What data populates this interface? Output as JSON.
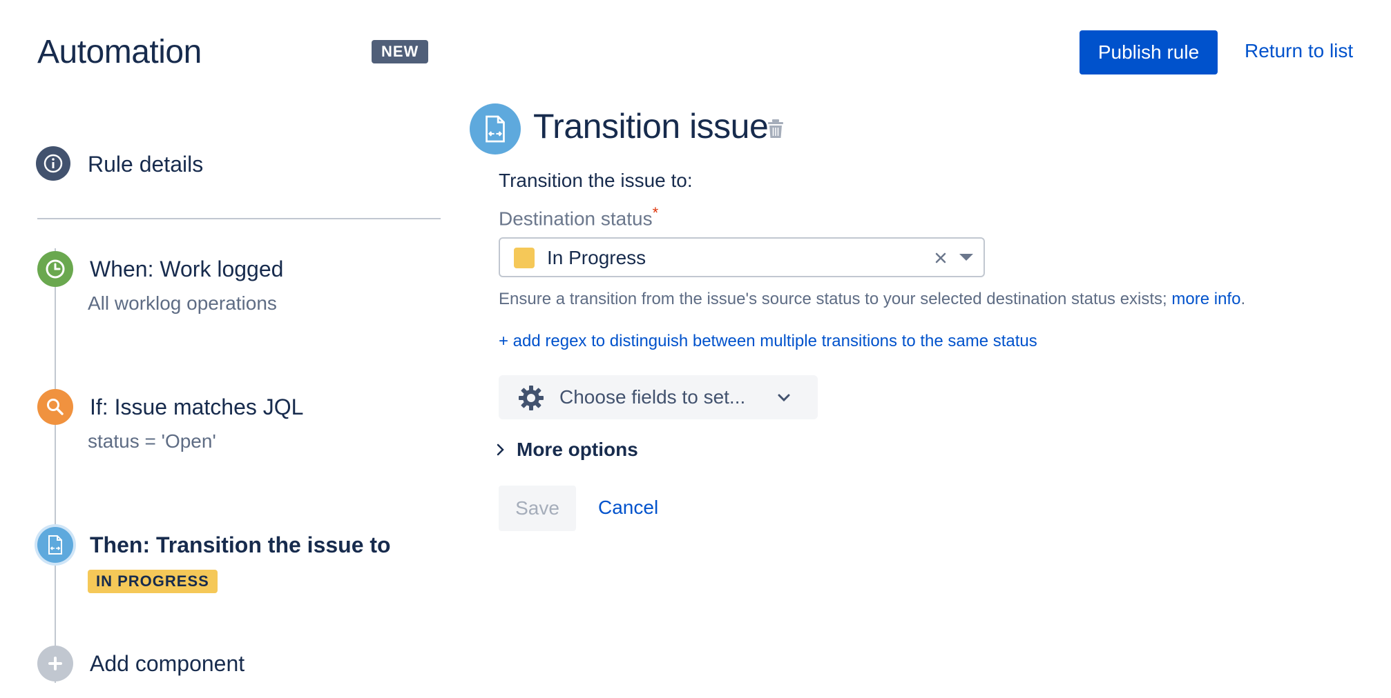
{
  "header": {
    "title": "Automation",
    "badge": "NEW",
    "publish_label": "Publish rule",
    "return_label": "Return to list"
  },
  "sidebar": {
    "rule_details": "Rule details",
    "trigger": {
      "label": "When: Work logged",
      "sub": "All worklog operations"
    },
    "condition": {
      "label": "If: Issue matches JQL",
      "sub": "status = 'Open'"
    },
    "action": {
      "label": "Then: Transition the issue to",
      "badge": "IN PROGRESS"
    },
    "add_component": "Add component"
  },
  "main": {
    "title": "Transition issue",
    "transition_to_label": "Transition the issue to:",
    "destination_label": "Destination status",
    "required_mark": "*",
    "selected_status": "In Progress",
    "helper_text": "Ensure a transition from the issue's source status to your selected destination status exists;",
    "helper_link": "more info",
    "helper_period": ".",
    "regex_link": "+ add regex to distinguish between multiple transitions to the same status",
    "choose_fields_label": "Choose fields to set...",
    "more_options_label": "More options",
    "save_label": "Save",
    "cancel_label": "Cancel"
  },
  "colors": {
    "primary": "#0052cc",
    "in_progress": "#f5c858",
    "trigger": "#6aa84f",
    "condition": "#f0923f",
    "action": "#5ea9dd",
    "info": "#42526e"
  }
}
